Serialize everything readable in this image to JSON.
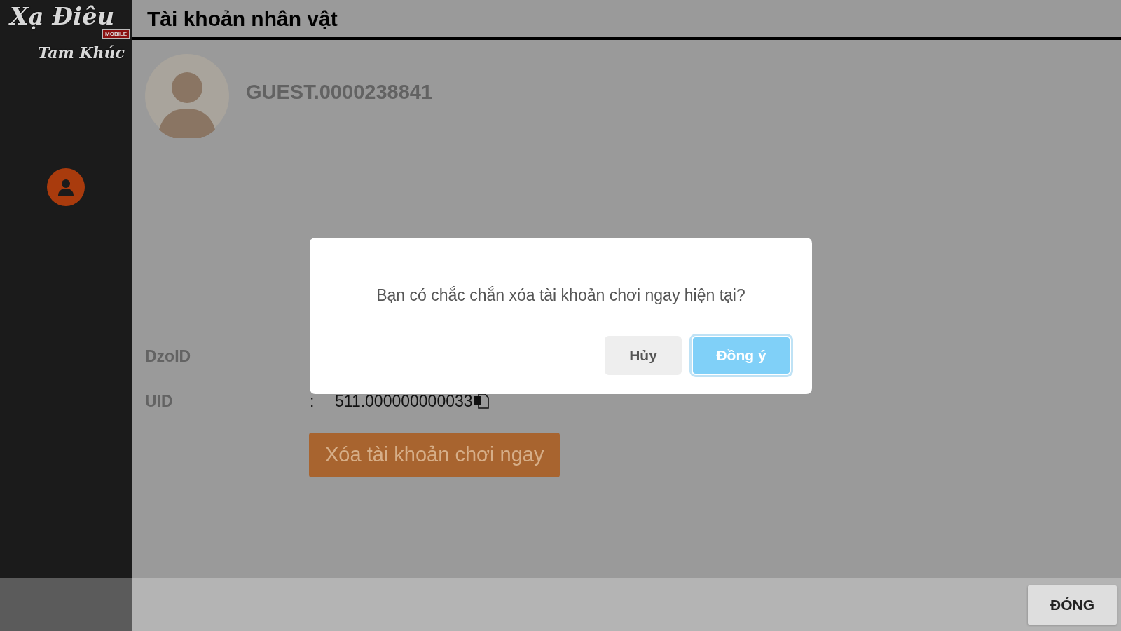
{
  "sidebar": {
    "logo": {
      "title": "Xạ Điêu",
      "subtitle": "Tam Khúc",
      "badge": "MOBILE"
    },
    "items": [
      {
        "kind": "user",
        "selected": true
      }
    ]
  },
  "header": {
    "title": "Tài khoản nhân vật"
  },
  "profile": {
    "username": "GUEST.0000238841"
  },
  "fields": [
    {
      "label": "DzoID"
    },
    {
      "label": "UID",
      "separator": ":",
      "value": "511.000000000033",
      "copyable": true
    }
  ],
  "delete_button": "Xóa tài khoản chơi ngay",
  "dialog": {
    "message": "Bạn có chắc chắn xóa tài khoản chơi ngay hiện tại?",
    "buttons": [
      {
        "label": "Hủy",
        "kind": "secondary",
        "focused": false
      },
      {
        "label": "Đồng ý",
        "kind": "primary",
        "focused": true
      }
    ]
  },
  "footer": {
    "close_button": "ĐÓNG"
  }
}
